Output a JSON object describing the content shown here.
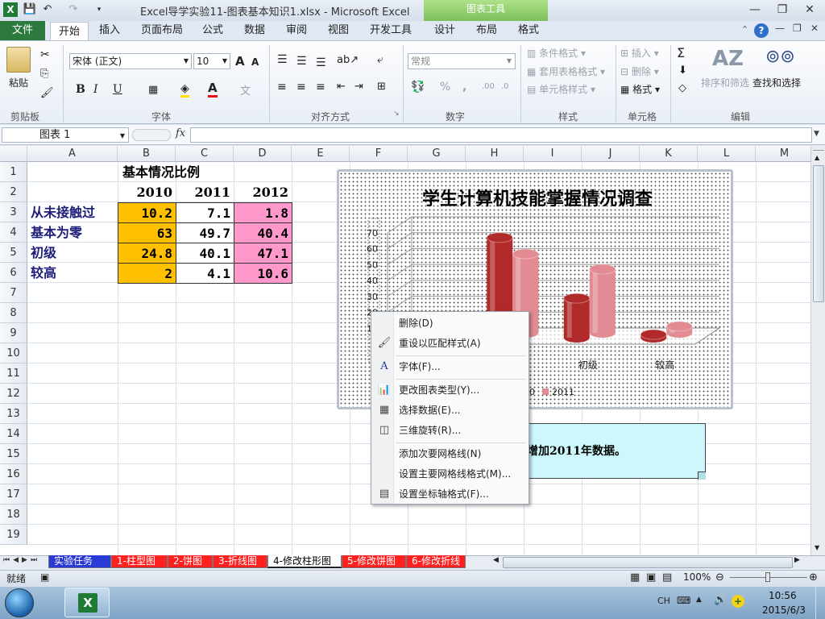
{
  "window": {
    "title": "Excel导学实验11-图表基本知识1.xlsx - Microsoft Excel",
    "context_tab_group": "图表工具",
    "minimize_glyph": "—",
    "restore_glyph": "❐",
    "close_glyph": "✕"
  },
  "quick_access": {
    "save": "💾",
    "undo": "↶",
    "redo": "↷"
  },
  "tabs": {
    "file": "文件",
    "items": [
      "开始",
      "插入",
      "页面布局",
      "公式",
      "数据",
      "审阅",
      "视图",
      "开发工具",
      "设计",
      "布局",
      "格式"
    ],
    "active": "开始"
  },
  "ribbon": {
    "clipboard": {
      "paste": "粘贴",
      "group": "剪贴板"
    },
    "font": {
      "name": "宋体 (正文)",
      "size": "10",
      "bold": "B",
      "italic": "I",
      "underline": "U",
      "group": "字体",
      "grow": "A",
      "shrink": "A"
    },
    "alignment": {
      "group": "对齐方式"
    },
    "number": {
      "format": "常规",
      "percent": "%",
      "comma": ",",
      "inc_dec": ".00",
      "dec_dec": ".0",
      "group": "数字"
    },
    "styles": {
      "conditional": "条件格式",
      "table": "套用表格格式",
      "cell": "单元格样式",
      "group": "样式"
    },
    "cells": {
      "insert": "插入",
      "delete": "删除",
      "format": "格式",
      "group": "单元格"
    },
    "editing": {
      "sort": "排序和筛选",
      "find": "查找和选择",
      "sum": "Σ",
      "group": "编辑"
    }
  },
  "formula_bar": {
    "name_box": "图表 1",
    "fx": "fx",
    "formula": ""
  },
  "columns": [
    "A",
    "B",
    "C",
    "D",
    "E",
    "F",
    "G",
    "H",
    "I",
    "J",
    "K",
    "L",
    "M"
  ],
  "rows": [
    "1",
    "2",
    "3",
    "4",
    "5",
    "6",
    "7",
    "8",
    "9",
    "10",
    "11",
    "12",
    "13",
    "14",
    "15",
    "16",
    "17",
    "18",
    "19"
  ],
  "table": {
    "title": "基本情况比例",
    "years": [
      "2010",
      "2011",
      "2012"
    ],
    "rows": [
      {
        "label": "从未接触过",
        "values": [
          "10.2",
          "7.1",
          "1.8"
        ]
      },
      {
        "label": "基本为零",
        "values": [
          "63",
          "49.7",
          "40.4"
        ]
      },
      {
        "label": "初级",
        "values": [
          "24.8",
          "40.1",
          "47.1"
        ]
      },
      {
        "label": "较高",
        "values": [
          "2",
          "4.1",
          "10.6"
        ]
      }
    ],
    "colors": {
      "col2010": "#ffc000",
      "col2011": "#ffffff",
      "col2012": "#ff99cc",
      "label": "#1d1d7a"
    }
  },
  "chart_data": {
    "type": "bar",
    "title": "学生计算机技能掌握情况调查",
    "categories": [
      "从未接触过",
      "基本为零",
      "初级",
      "较高"
    ],
    "visible_category_labels": [
      "初级",
      "较高"
    ],
    "series": [
      {
        "name": "2010",
        "values": [
          10.2,
          63,
          24.8,
          2
        ],
        "color": "#b02a2a"
      },
      {
        "name": "2011",
        "values": [
          7.1,
          49.7,
          40.1,
          4.1
        ],
        "color": "#e28b92"
      }
    ],
    "y_ticks": [
      "0",
      "10",
      "20",
      "30",
      "40",
      "50",
      "60",
      "70"
    ],
    "y_tick_labels_visible": [
      "70",
      "60",
      "50",
      "40",
      "30",
      "20",
      "10"
    ],
    "ylim": [
      0,
      70
    ],
    "legend_visible_text": [
      "0",
      "2011"
    ],
    "style": "3d-cylinder"
  },
  "note": {
    "text": "增加2011年数据。"
  },
  "context_menu": [
    {
      "label": "删除(D)",
      "icon": "delete-icon",
      "glyph": ""
    },
    {
      "label": "重设以匹配样式(A)",
      "icon": "reset-style-icon",
      "glyph": "🖌"
    },
    {
      "label": "字体(F)...",
      "icon": "font-icon",
      "glyph": "A"
    },
    {
      "label": "更改图表类型(Y)...",
      "icon": "chart-type-icon",
      "glyph": "📊"
    },
    {
      "label": "选择数据(E)...",
      "icon": "select-data-icon",
      "glyph": "▦"
    },
    {
      "label": "三维旋转(R)...",
      "icon": "3d-rotation-icon",
      "glyph": "◫"
    },
    {
      "label": "添加次要网格线(N)",
      "icon": "",
      "glyph": ""
    },
    {
      "label": "设置主要网格线格式(M)...",
      "icon": "",
      "glyph": ""
    },
    {
      "label": "设置坐标轴格式(F)...",
      "icon": "axis-format-icon",
      "glyph": "▤"
    }
  ],
  "sheet_tabs": [
    {
      "label": "实验任务",
      "bg": "#2a3ad6",
      "fg": "#ffffff"
    },
    {
      "label": "1-柱型图",
      "bg": "#ff2020",
      "fg": "#ffffff"
    },
    {
      "label": "2-饼图",
      "bg": "#ff2020",
      "fg": "#ffffff"
    },
    {
      "label": "3-折线图",
      "bg": "#ff2020",
      "fg": "#ffffff"
    },
    {
      "label": "4-修改柱形图",
      "bg": "#ffffff",
      "fg": "#000000"
    },
    {
      "label": "5-修改饼图",
      "bg": "#ff2020",
      "fg": "#ffffff"
    },
    {
      "label": "6-修改折线",
      "bg": "#ff2020",
      "fg": "#ffffff"
    }
  ],
  "status": {
    "ready": "就绪",
    "zoom": "100%"
  },
  "taskbar": {
    "lang": "CH",
    "time": "10:56",
    "date": "2015/6/3"
  }
}
